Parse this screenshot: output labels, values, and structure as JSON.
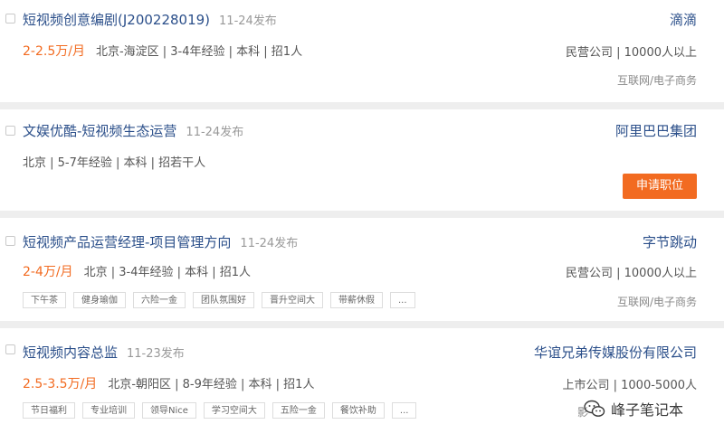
{
  "jobs": [
    {
      "title": "短视频创意编剧(J200228019)",
      "date": "11-24发布",
      "company": "滴滴",
      "salary": "2-2.5万/月",
      "meta": "北京-海淀区 | 3-4年经验 | 本科 | 招1人",
      "company_meta": "民营公司 | 10000人以上",
      "industry": "互联网/电子商务"
    },
    {
      "title": "文娱优酷-短视频生态运营",
      "date": "11-24发布",
      "company": "阿里巴巴集团",
      "salary": "",
      "meta": "北京 | 5-7年经验 | 本科 | 招若干人",
      "apply_label": "申请职位"
    },
    {
      "title": "短视频产品运营经理-项目管理方向",
      "date": "11-24发布",
      "company": "字节跳动",
      "salary": "2-4万/月",
      "meta": "北京 | 3-4年经验 | 本科 | 招1人",
      "company_meta": "民营公司 | 10000人以上",
      "industry": "互联网/电子商务",
      "tags": [
        "下午茶",
        "健身瑜伽",
        "六险一金",
        "团队氛围好",
        "晋升空间大",
        "带薪休假",
        "..."
      ]
    },
    {
      "title": "短视频内容总监",
      "date": "11-23发布",
      "company": "华谊兄弟传媒股份有限公司",
      "salary": "2.5-3.5万/月",
      "meta": "北京-朝阳区 | 8-9年经验 | 本科 | 招1人",
      "company_meta": "上市公司 | 1000-5000人",
      "industry": "影",
      "tags": [
        "节日福利",
        "专业培训",
        "领导Nice",
        "学习空间大",
        "五险一金",
        "餐饮补助",
        "..."
      ]
    }
  ],
  "watermark": {
    "text": "峰子笔记本",
    "icon": "wechat-icon"
  },
  "colors": {
    "title": "#2b4f8a",
    "salary": "#f26b21",
    "button": "#f26b21"
  }
}
